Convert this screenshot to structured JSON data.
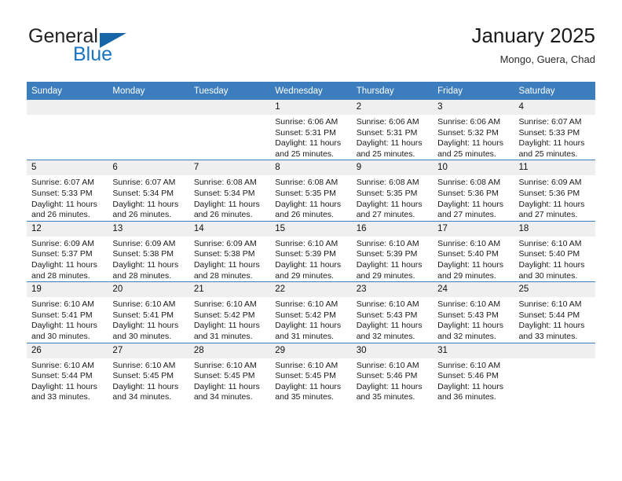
{
  "brand": {
    "name_top": "General",
    "name_bottom": "Blue",
    "triangle_color": "#1565a8",
    "blue_color": "#1874c4"
  },
  "header": {
    "title": "January 2025",
    "subtitle": "Mongo, Guera, Chad"
  },
  "theme": {
    "header_bg": "#3b7dbd",
    "daynum_bg": "#efefef",
    "row_divider": "#3b7dbd"
  },
  "calendar": {
    "weekday_headers": [
      "Sunday",
      "Monday",
      "Tuesday",
      "Wednesday",
      "Thursday",
      "Friday",
      "Saturday"
    ],
    "weeks": [
      [
        {
          "day": "",
          "lines": []
        },
        {
          "day": "",
          "lines": []
        },
        {
          "day": "",
          "lines": []
        },
        {
          "day": "1",
          "lines": [
            "Sunrise: 6:06 AM",
            "Sunset: 5:31 PM",
            "Daylight: 11 hours and 25 minutes."
          ]
        },
        {
          "day": "2",
          "lines": [
            "Sunrise: 6:06 AM",
            "Sunset: 5:31 PM",
            "Daylight: 11 hours and 25 minutes."
          ]
        },
        {
          "day": "3",
          "lines": [
            "Sunrise: 6:06 AM",
            "Sunset: 5:32 PM",
            "Daylight: 11 hours and 25 minutes."
          ]
        },
        {
          "day": "4",
          "lines": [
            "Sunrise: 6:07 AM",
            "Sunset: 5:33 PM",
            "Daylight: 11 hours and 25 minutes."
          ]
        }
      ],
      [
        {
          "day": "5",
          "lines": [
            "Sunrise: 6:07 AM",
            "Sunset: 5:33 PM",
            "Daylight: 11 hours and 26 minutes."
          ]
        },
        {
          "day": "6",
          "lines": [
            "Sunrise: 6:07 AM",
            "Sunset: 5:34 PM",
            "Daylight: 11 hours and 26 minutes."
          ]
        },
        {
          "day": "7",
          "lines": [
            "Sunrise: 6:08 AM",
            "Sunset: 5:34 PM",
            "Daylight: 11 hours and 26 minutes."
          ]
        },
        {
          "day": "8",
          "lines": [
            "Sunrise: 6:08 AM",
            "Sunset: 5:35 PM",
            "Daylight: 11 hours and 26 minutes."
          ]
        },
        {
          "day": "9",
          "lines": [
            "Sunrise: 6:08 AM",
            "Sunset: 5:35 PM",
            "Daylight: 11 hours and 27 minutes."
          ]
        },
        {
          "day": "10",
          "lines": [
            "Sunrise: 6:08 AM",
            "Sunset: 5:36 PM",
            "Daylight: 11 hours and 27 minutes."
          ]
        },
        {
          "day": "11",
          "lines": [
            "Sunrise: 6:09 AM",
            "Sunset: 5:36 PM",
            "Daylight: 11 hours and 27 minutes."
          ]
        }
      ],
      [
        {
          "day": "12",
          "lines": [
            "Sunrise: 6:09 AM",
            "Sunset: 5:37 PM",
            "Daylight: 11 hours and 28 minutes."
          ]
        },
        {
          "day": "13",
          "lines": [
            "Sunrise: 6:09 AM",
            "Sunset: 5:38 PM",
            "Daylight: 11 hours and 28 minutes."
          ]
        },
        {
          "day": "14",
          "lines": [
            "Sunrise: 6:09 AM",
            "Sunset: 5:38 PM",
            "Daylight: 11 hours and 28 minutes."
          ]
        },
        {
          "day": "15",
          "lines": [
            "Sunrise: 6:10 AM",
            "Sunset: 5:39 PM",
            "Daylight: 11 hours and 29 minutes."
          ]
        },
        {
          "day": "16",
          "lines": [
            "Sunrise: 6:10 AM",
            "Sunset: 5:39 PM",
            "Daylight: 11 hours and 29 minutes."
          ]
        },
        {
          "day": "17",
          "lines": [
            "Sunrise: 6:10 AM",
            "Sunset: 5:40 PM",
            "Daylight: 11 hours and 29 minutes."
          ]
        },
        {
          "day": "18",
          "lines": [
            "Sunrise: 6:10 AM",
            "Sunset: 5:40 PM",
            "Daylight: 11 hours and 30 minutes."
          ]
        }
      ],
      [
        {
          "day": "19",
          "lines": [
            "Sunrise: 6:10 AM",
            "Sunset: 5:41 PM",
            "Daylight: 11 hours and 30 minutes."
          ]
        },
        {
          "day": "20",
          "lines": [
            "Sunrise: 6:10 AM",
            "Sunset: 5:41 PM",
            "Daylight: 11 hours and 30 minutes."
          ]
        },
        {
          "day": "21",
          "lines": [
            "Sunrise: 6:10 AM",
            "Sunset: 5:42 PM",
            "Daylight: 11 hours and 31 minutes."
          ]
        },
        {
          "day": "22",
          "lines": [
            "Sunrise: 6:10 AM",
            "Sunset: 5:42 PM",
            "Daylight: 11 hours and 31 minutes."
          ]
        },
        {
          "day": "23",
          "lines": [
            "Sunrise: 6:10 AM",
            "Sunset: 5:43 PM",
            "Daylight: 11 hours and 32 minutes."
          ]
        },
        {
          "day": "24",
          "lines": [
            "Sunrise: 6:10 AM",
            "Sunset: 5:43 PM",
            "Daylight: 11 hours and 32 minutes."
          ]
        },
        {
          "day": "25",
          "lines": [
            "Sunrise: 6:10 AM",
            "Sunset: 5:44 PM",
            "Daylight: 11 hours and 33 minutes."
          ]
        }
      ],
      [
        {
          "day": "26",
          "lines": [
            "Sunrise: 6:10 AM",
            "Sunset: 5:44 PM",
            "Daylight: 11 hours and 33 minutes."
          ]
        },
        {
          "day": "27",
          "lines": [
            "Sunrise: 6:10 AM",
            "Sunset: 5:45 PM",
            "Daylight: 11 hours and 34 minutes."
          ]
        },
        {
          "day": "28",
          "lines": [
            "Sunrise: 6:10 AM",
            "Sunset: 5:45 PM",
            "Daylight: 11 hours and 34 minutes."
          ]
        },
        {
          "day": "29",
          "lines": [
            "Sunrise: 6:10 AM",
            "Sunset: 5:45 PM",
            "Daylight: 11 hours and 35 minutes."
          ]
        },
        {
          "day": "30",
          "lines": [
            "Sunrise: 6:10 AM",
            "Sunset: 5:46 PM",
            "Daylight: 11 hours and 35 minutes."
          ]
        },
        {
          "day": "31",
          "lines": [
            "Sunrise: 6:10 AM",
            "Sunset: 5:46 PM",
            "Daylight: 11 hours and 36 minutes."
          ]
        },
        {
          "day": "",
          "lines": []
        }
      ]
    ]
  }
}
